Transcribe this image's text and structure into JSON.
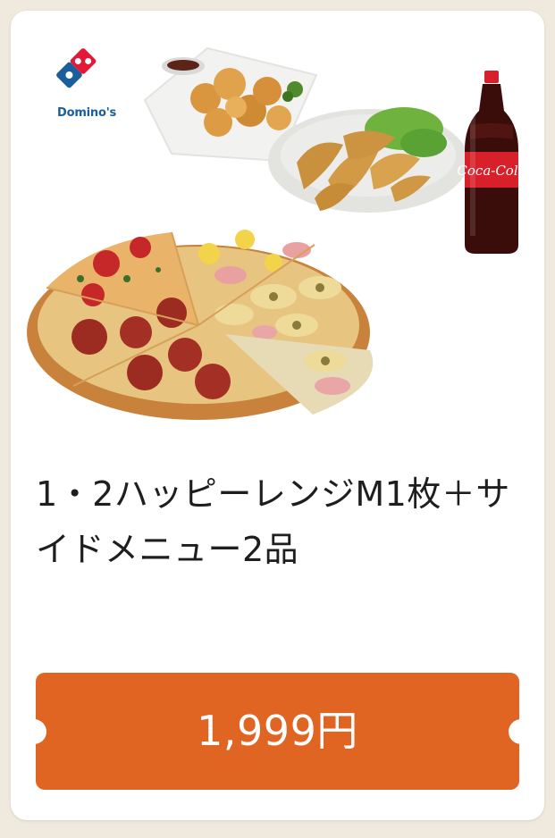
{
  "brand": {
    "name": "Domino's",
    "logo_icon": "dominos-logo-icon"
  },
  "product": {
    "title": "1・2ハッピーレンジM1枚＋サイドメニュー2品",
    "images": [
      "fried-chicken-image",
      "potato-wedges-image",
      "coca-cola-bottle-image",
      "pizza-image"
    ]
  },
  "coupon": {
    "price_label": "1,999円"
  },
  "colors": {
    "background": "#efe9de",
    "card": "#ffffff",
    "accent": "#e06422",
    "brand_blue": "#1a5e9b",
    "brand_red": "#e31837"
  }
}
